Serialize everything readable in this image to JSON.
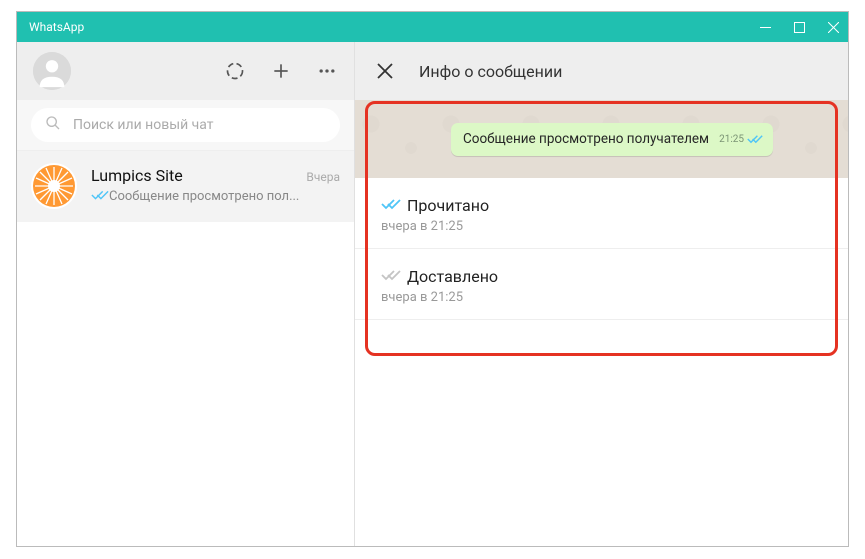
{
  "titlebar": {
    "title": "WhatsApp"
  },
  "search": {
    "placeholder": "Поиск или новый чат"
  },
  "chat": {
    "name": "Lumpics Site",
    "time": "Вчера",
    "preview": "Сообщение просмотрено пол..."
  },
  "info_header": {
    "title": "Инфо о сообщении"
  },
  "message": {
    "text": "Сообщение просмотрено получателем",
    "time": "21:25"
  },
  "read": {
    "label": "Прочитано",
    "time": "вчера в 21:25"
  },
  "delivered": {
    "label": "Доставлено",
    "time": "вчера в 21:25"
  }
}
